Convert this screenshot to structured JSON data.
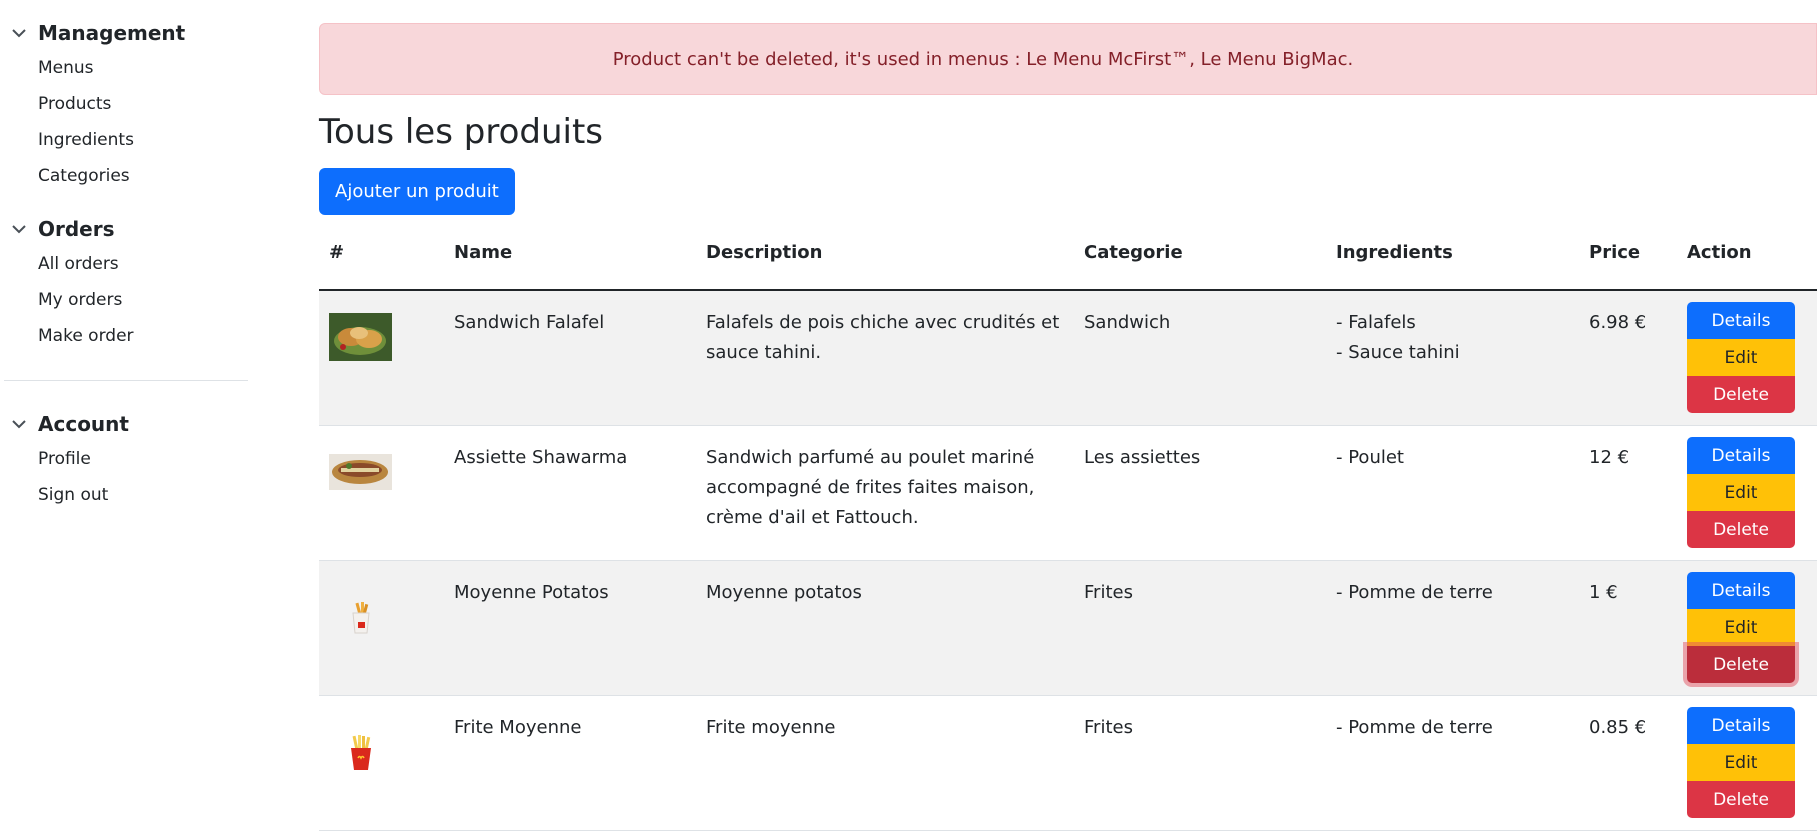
{
  "sidebar": {
    "groups": [
      {
        "title": "Management",
        "items": [
          "Menus",
          "Products",
          "Ingredients",
          "Categories"
        ]
      },
      {
        "title": "Orders",
        "items": [
          "All orders",
          "My orders",
          "Make order"
        ]
      },
      {
        "title": "Account",
        "items": [
          "Profile",
          "Sign out"
        ]
      }
    ]
  },
  "alert": {
    "message": "Product can't be deleted, it's used in menus : Le Menu McFirst™, Le Menu BigMac."
  },
  "page": {
    "title": "Tous les produits",
    "add_button": "Ajouter un produit"
  },
  "table": {
    "headers": [
      "#",
      "Name",
      "Description",
      "Categorie",
      "Ingredients",
      "Price",
      "Action"
    ],
    "actions": {
      "details": "Details",
      "edit": "Edit",
      "delete": "Delete"
    },
    "rows": [
      {
        "image_icon": "falafel-sandwich-image",
        "name": "Sandwich Falafel",
        "description": "Falafels de pois chiche avec crudités et sauce tahini.",
        "category": "Sandwich",
        "ingredients": [
          "- Falafels",
          "- Sauce tahini"
        ],
        "price": "6.98 €"
      },
      {
        "image_icon": "shawarma-plate-image",
        "name": "Assiette Shawarma",
        "description": "Sandwich parfumé au poulet mariné accompagné de frites faites maison, crème d'ail et Fattouch.",
        "category": "Les assiettes",
        "ingredients": [
          "- Poulet"
        ],
        "price": "12 €"
      },
      {
        "image_icon": "potatoes-box-image",
        "name": "Moyenne Potatos",
        "description": "Moyenne potatos",
        "category": "Frites",
        "ingredients": [
          "- Pomme de terre"
        ],
        "price": "1 €"
      },
      {
        "image_icon": "fries-box-image",
        "name": "Frite Moyenne",
        "description": "Frite moyenne",
        "category": "Frites",
        "ingredients": [
          "- Pomme de terre"
        ],
        "price": "0.85 €"
      }
    ]
  },
  "colors": {
    "primary": "#0d6efd",
    "warning": "#ffc107",
    "danger": "#dc3545",
    "alert_bg": "#f8d7da",
    "alert_text": "#842029"
  }
}
